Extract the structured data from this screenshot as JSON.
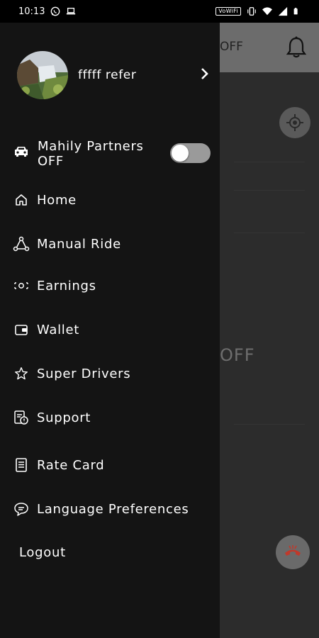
{
  "status_bar": {
    "time": "10:13",
    "vowifi_label": "VoWiFi",
    "icons": [
      "whatsapp-icon",
      "laptop-icon",
      "vibrate-icon",
      "wifi-icon",
      "signal-icon",
      "battery-icon"
    ]
  },
  "background": {
    "header_text": "OFF",
    "status_text": "OFF",
    "icons": [
      "bell-icon",
      "locate-icon",
      "end-call-icon"
    ]
  },
  "drawer": {
    "profile": {
      "name": "fffff refer"
    },
    "partners": {
      "line1": "Mahily Partners",
      "line2": "OFF",
      "toggle_on": false
    },
    "items": [
      {
        "label": "Home",
        "icon": "home-icon"
      },
      {
        "label": "Manual Ride",
        "icon": "route-icon"
      },
      {
        "label": "Earnings",
        "icon": "earnings-icon"
      },
      {
        "label": "Wallet",
        "icon": "wallet-icon"
      },
      {
        "label": "Super Drivers",
        "icon": "star-icon"
      },
      {
        "label": "Support",
        "icon": "support-icon"
      },
      {
        "label": "Rate Card",
        "icon": "rate-card-icon"
      },
      {
        "label": "Language Preferences",
        "icon": "language-icon"
      }
    ],
    "logout": "Logout"
  },
  "colors": {
    "drawer_bg": "#141414",
    "dim_bg": "#2c2c2c",
    "header_bg": "#6c6c6c",
    "text": "#ffffff",
    "call_icon": "#d9534f"
  }
}
